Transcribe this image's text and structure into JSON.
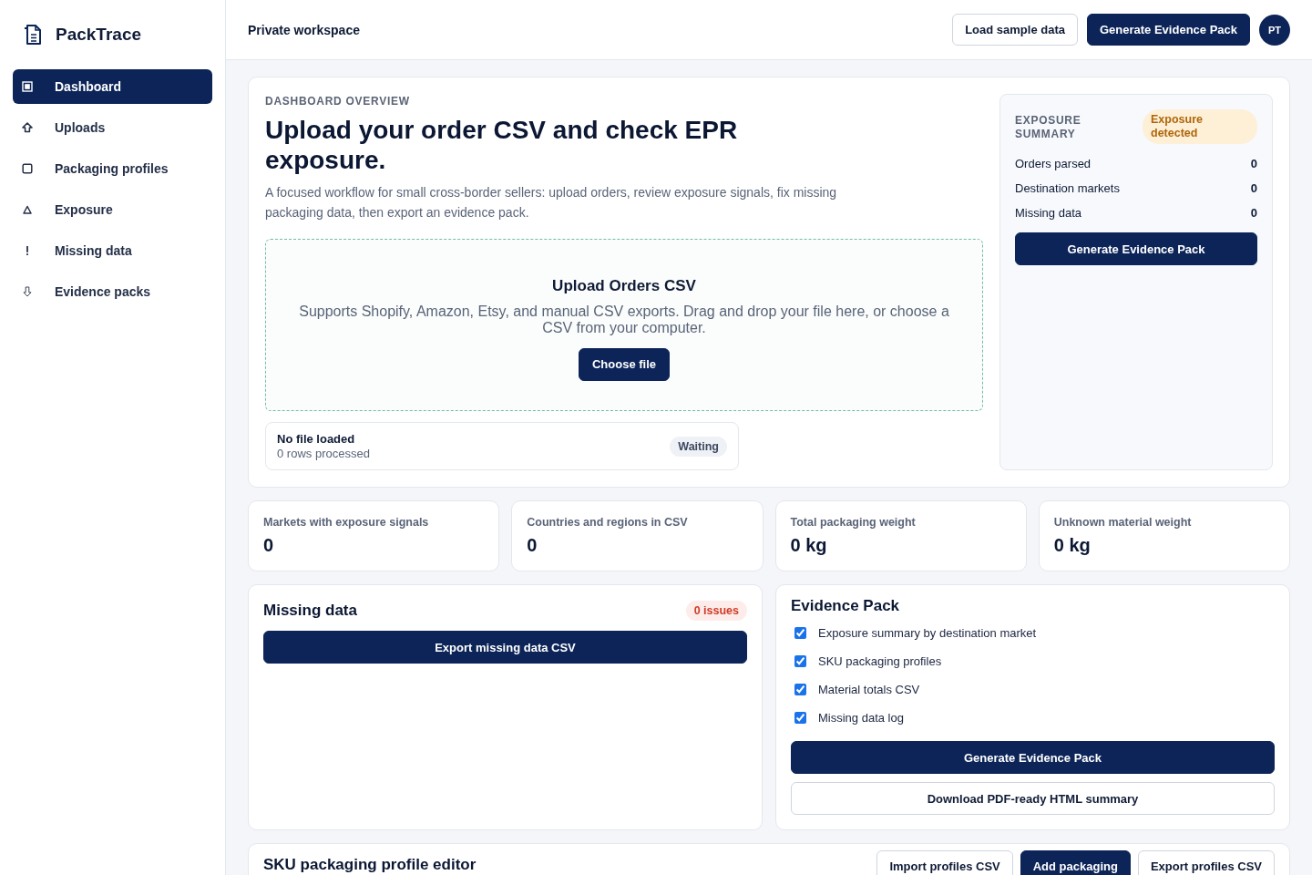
{
  "sidebar": {
    "brand": "PackTrace",
    "items": [
      {
        "label": "Dashboard",
        "selected": true
      },
      {
        "label": "Uploads",
        "selected": false
      },
      {
        "label": "Packaging profiles",
        "selected": false
      },
      {
        "label": "Exposure",
        "selected": false
      },
      {
        "label": "Missing data",
        "selected": false
      },
      {
        "label": "Evidence packs",
        "selected": false
      }
    ]
  },
  "header": {
    "title": "Private workspace",
    "buttons": [
      {
        "label": "Load sample data",
        "kind": "outline"
      },
      {
        "label": "Generate Evidence Pack",
        "kind": "primary"
      }
    ],
    "avatar": "PT"
  },
  "overview": {
    "eyebrow": "DASHBOARD OVERVIEW",
    "title": "Upload your order CSV and check EPR exposure.",
    "description": "A focused workflow for small cross-border sellers: upload orders, review exposure signals, fix missing packaging data, then export an evidence pack.",
    "upload": {
      "title": "Upload Orders CSV",
      "description": "Supports Shopify, Amazon, Etsy, and manual CSV exports. Drag and drop your file here, or choose a CSV from your computer.",
      "button": "Choose file"
    },
    "file_status": {
      "title": "No file loaded",
      "detail": "0 rows processed",
      "badge": "Waiting"
    },
    "summary": {
      "title": "EXPOSURE SUMMARY",
      "badge": "Exposure detected",
      "rows": [
        {
          "label": "Orders parsed",
          "value": "0"
        },
        {
          "label": "Destination markets",
          "value": "0"
        },
        {
          "label": "Missing data",
          "value": "0"
        }
      ],
      "button": "Generate Evidence Pack"
    }
  },
  "stats": [
    {
      "label": "Markets with exposure signals",
      "value": "0"
    },
    {
      "label": "Countries and regions in CSV",
      "value": "0"
    },
    {
      "label": "Total packaging weight",
      "value": "0 kg"
    },
    {
      "label": "Unknown material weight",
      "value": "0 kg"
    }
  ],
  "missing_data": {
    "title": "Missing data",
    "badge": "0 issues",
    "button": "Export missing data CSV"
  },
  "evidence_pack": {
    "title": "Evidence Pack",
    "items": [
      {
        "label": "Exposure summary by destination market",
        "checked": true
      },
      {
        "label": "SKU packaging profiles",
        "checked": true
      },
      {
        "label": "Material totals CSV",
        "checked": true
      },
      {
        "label": "Missing data log",
        "checked": true
      }
    ],
    "buttons": [
      {
        "label": "Generate Evidence Pack",
        "kind": "primary"
      },
      {
        "label": "Download PDF-ready HTML summary",
        "kind": "outline"
      }
    ]
  },
  "profile_editor": {
    "title": "SKU packaging profile editor",
    "buttons": [
      {
        "label": "Import profiles CSV",
        "kind": "outline"
      },
      {
        "label": "Add packaging",
        "kind": "primary"
      },
      {
        "label": "Export profiles CSV",
        "kind": "outline"
      }
    ]
  }
}
